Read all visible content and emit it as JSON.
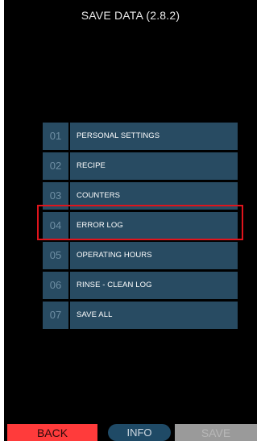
{
  "title": "SAVE DATA (2.8.2)",
  "menu": {
    "items": [
      {
        "number": "01",
        "label": "PERSONAL SETTINGS"
      },
      {
        "number": "02",
        "label": "RECIPE"
      },
      {
        "number": "03",
        "label": "COUNTERS"
      },
      {
        "number": "04",
        "label": "ERROR LOG"
      },
      {
        "number": "05",
        "label": "OPERATING HOURS"
      },
      {
        "number": "06",
        "label": "RINSE - CLEAN LOG"
      },
      {
        "number": "07",
        "label": "SAVE ALL"
      }
    ],
    "highlighted_index": 3
  },
  "footer": {
    "back_label": "BACK",
    "info_label": "INFO",
    "save_label": "SAVE"
  },
  "colors": {
    "background": "#000000",
    "menu_row": "#284b62",
    "number_text": "#6f8fa4",
    "highlight_border": "#e0141c",
    "back_button": "#ff3b3b",
    "info_button": "#1f4a66",
    "save_button_disabled": "#9a9a9a"
  }
}
